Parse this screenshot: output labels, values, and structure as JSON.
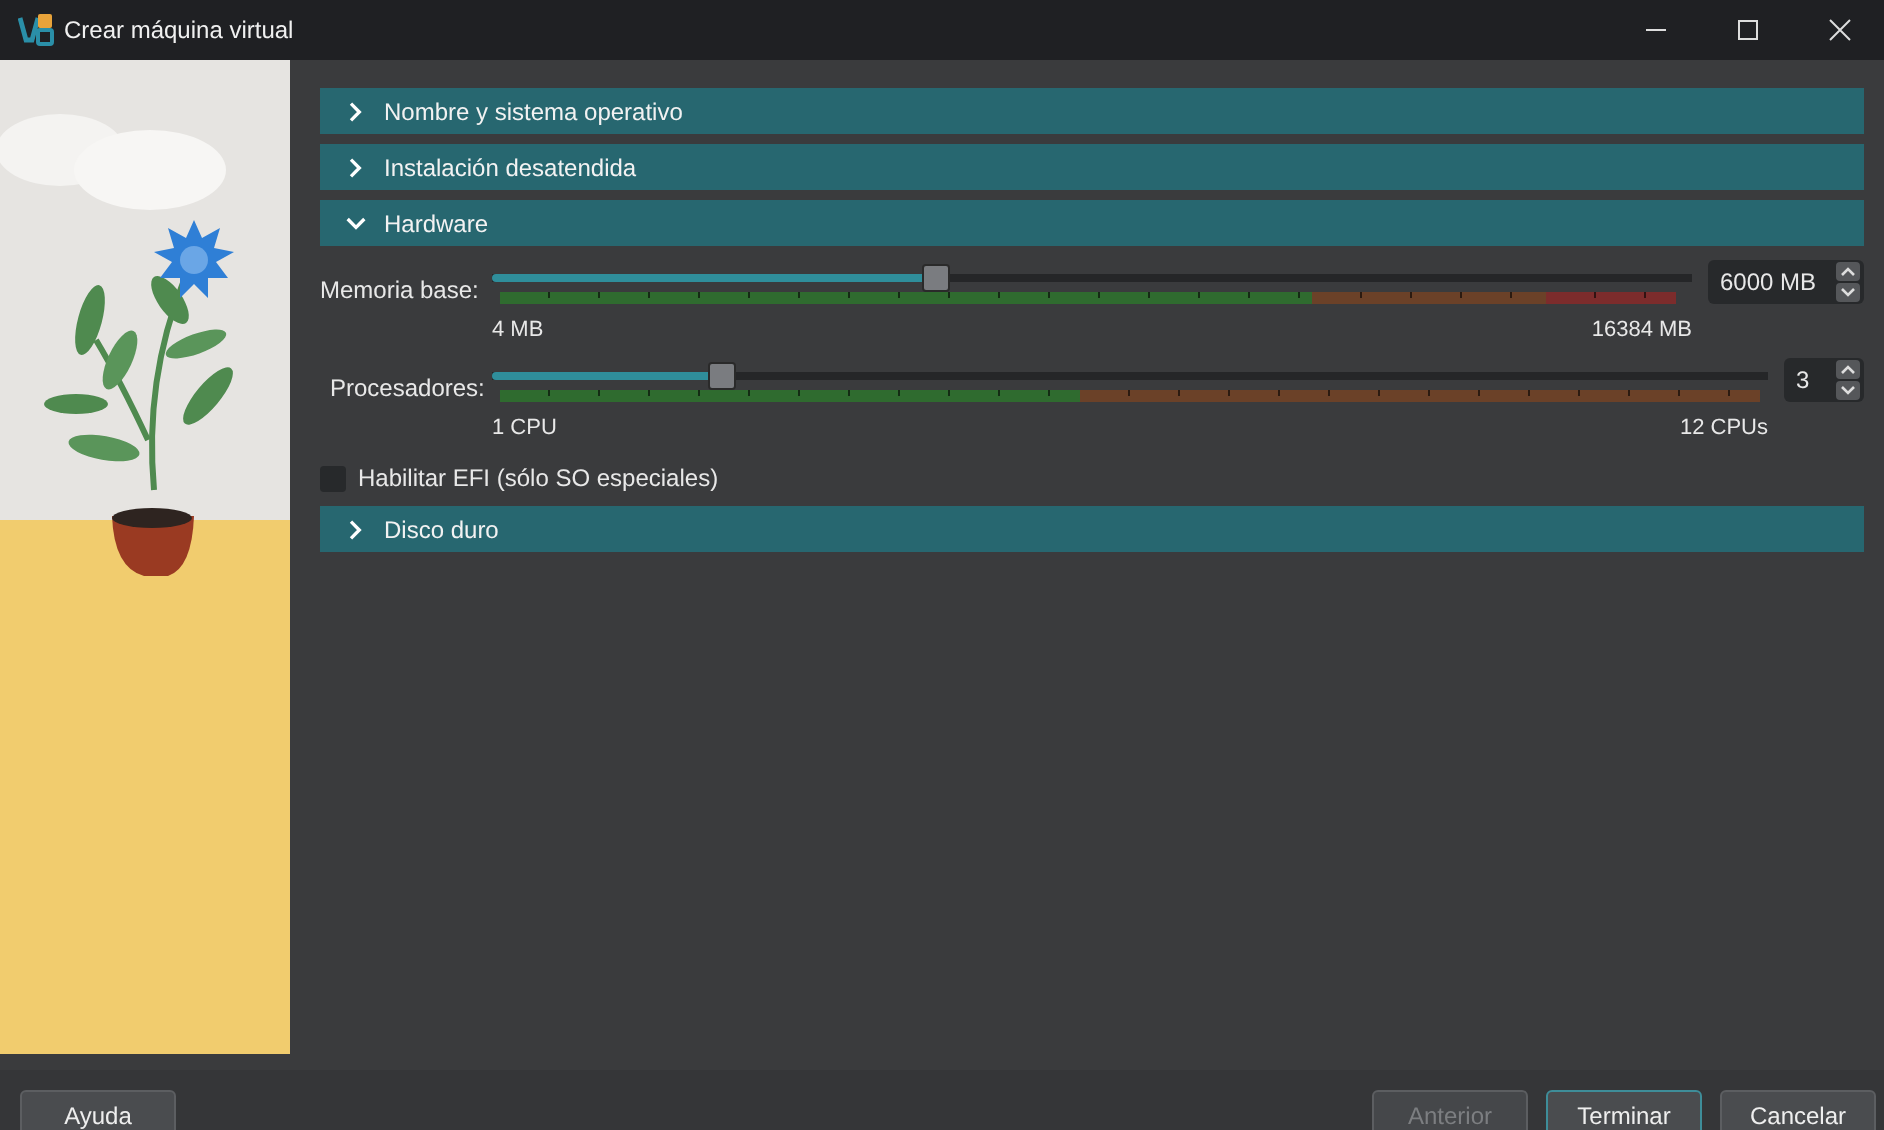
{
  "window": {
    "title": "Crear máquina virtual"
  },
  "sections": [
    {
      "title": "Nombre y sistema operativo",
      "expanded": false
    },
    {
      "title": "Instalación desatendida",
      "expanded": false
    },
    {
      "title": "Hardware",
      "expanded": true,
      "sliders": [
        {
          "kind": "memory",
          "label": "Memoria base:",
          "level": 0.37,
          "value": "6000 MB",
          "min_label": "4 MB",
          "max_label": "16384 MB"
        },
        {
          "kind": "cpu",
          "label": "Procesadores:",
          "level": 0.18,
          "value": "3",
          "min_label": "1 CPU",
          "max_label": "12 CPUs"
        }
      ],
      "checkbox": {
        "label": "Habilitar EFI (sólo SO especiales)",
        "checked": false
      }
    },
    {
      "title": "Disco duro",
      "expanded": false
    }
  ],
  "buttons": [
    {
      "label": "Ayuda",
      "disabled": false,
      "default": false
    },
    {
      "label": "Anterior",
      "disabled": true,
      "default": false
    },
    {
      "label": "Terminar",
      "disabled": false,
      "default": true
    },
    {
      "label": "Cancelar",
      "disabled": false,
      "default": false
    }
  ]
}
